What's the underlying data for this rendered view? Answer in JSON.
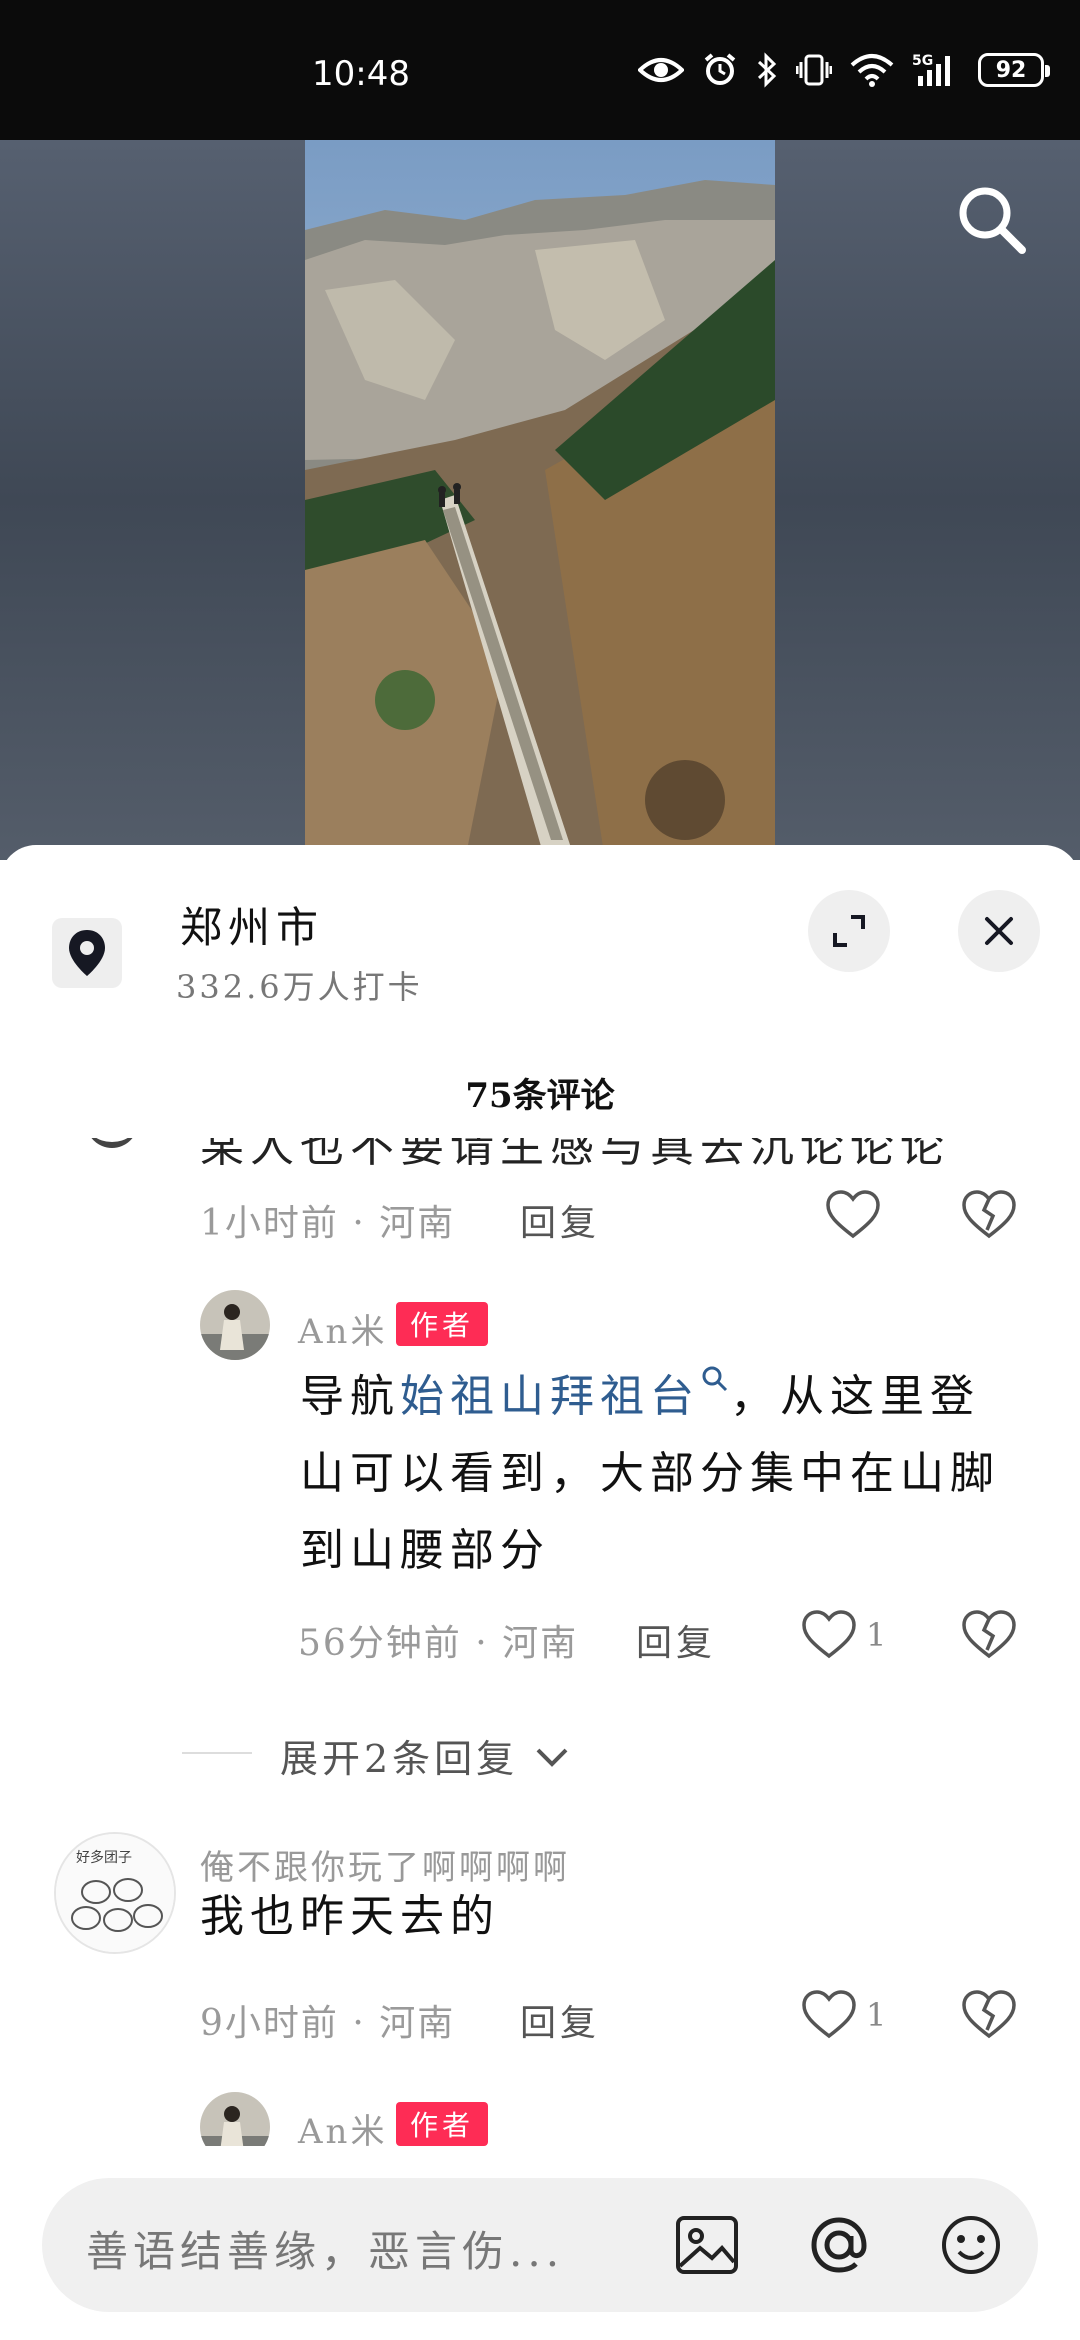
{
  "status_bar": {
    "time": "10:48",
    "battery": "92",
    "network": "5G"
  },
  "location": {
    "title": "郑州市",
    "subtitle": "332.6万人打卡"
  },
  "comments_header": {
    "count_label": "75条评论"
  },
  "comments": [
    {
      "partial_text": "某人也不要请生感与真去沉论论论",
      "meta": "1小时前 · 河南",
      "reply_label": "回复",
      "likes": ""
    },
    {
      "author": "An米",
      "tag": "作者",
      "text_before": "导航",
      "keyword": "始祖山拜祖台",
      "text_after": "，从这里登山可以看到，大部分集中在山脚到山腰部分",
      "meta": "56分钟前 · 河南",
      "reply_label": "回复",
      "likes": "1"
    },
    {
      "expand_label": "展开2条回复"
    },
    {
      "author": "俺不跟你玩了啊啊啊啊",
      "text": "我也昨天去的",
      "meta": "9小时前 · 河南",
      "reply_label": "回复",
      "likes": "1"
    },
    {
      "author": "An米",
      "tag": "作者"
    }
  ],
  "input": {
    "placeholder": "善语结善缘，恶言伤..."
  },
  "icons": {
    "search": "search-icon",
    "location": "location-pin-icon",
    "expand": "expand-icon",
    "close": "close-icon",
    "heart": "heart-icon",
    "dislike": "broken-heart-icon",
    "image": "image-icon",
    "mention": "at-icon",
    "emoji": "emoji-icon"
  }
}
